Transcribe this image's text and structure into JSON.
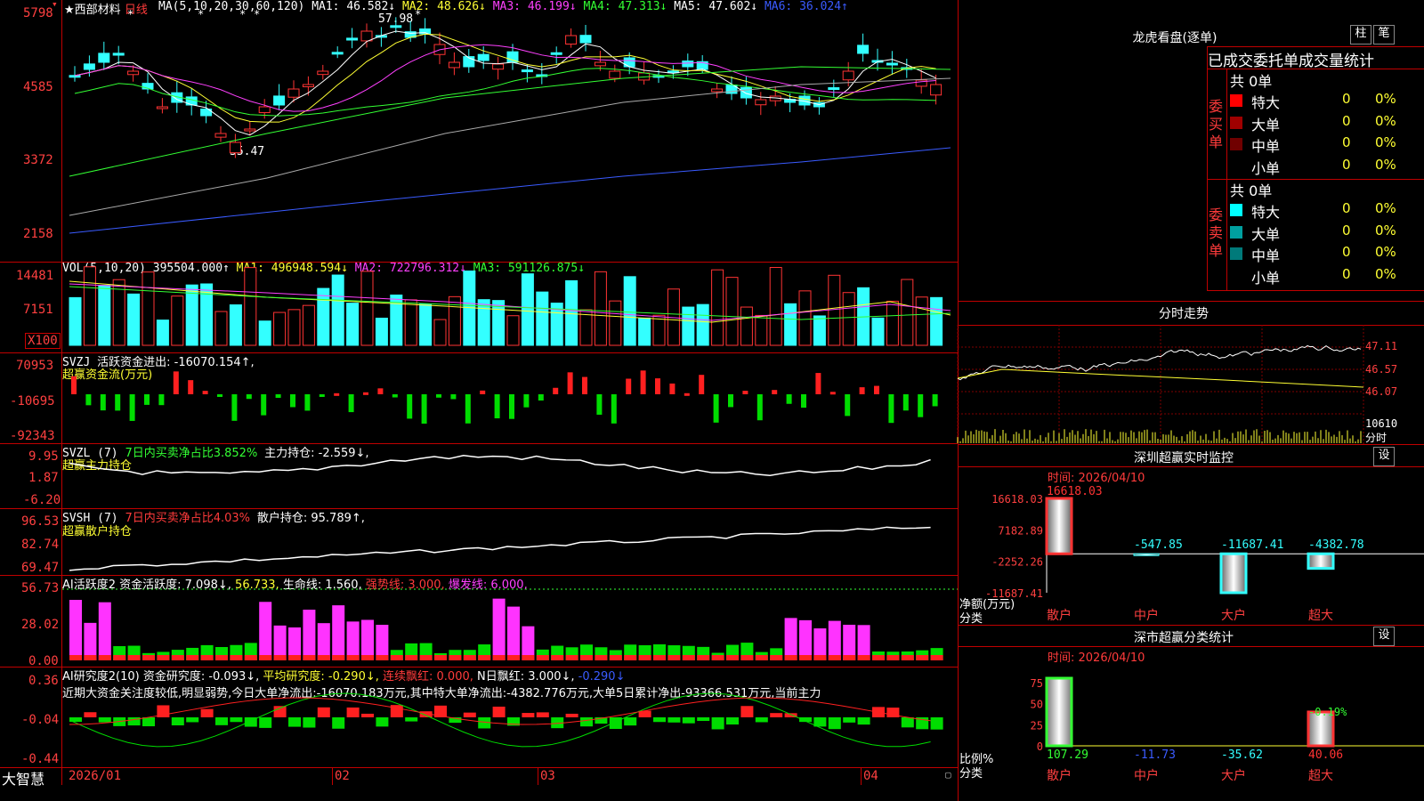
{
  "stock": {
    "star": "★",
    "name": "西部材料",
    "period": "日线"
  },
  "ma_header": {
    "label": "MA(5,10,20,30,60,120)",
    "ma1": "MA1: 46.582↓",
    "ma2": "MA2: 48.626↓",
    "ma3": "MA3: 46.199↓",
    "ma4": "MA4: 47.313↓",
    "ma5": "MA5: 47.602↓",
    "ma6": "MA6: 36.024↑"
  },
  "price_axis": [
    "5798",
    "4585",
    "3372",
    "2158"
  ],
  "price_annotations": {
    "high": "57.98",
    "low": "35.47"
  },
  "vol_header": {
    "label": "VOL(5,10,20)",
    "value": "395504.000↑",
    "ma1": "MA1: 496948.594↓",
    "ma2": "MA2: 722796.312↓",
    "ma3": "MA3: 591126.875↓"
  },
  "vol_axis": [
    "14481",
    "7151",
    "X100"
  ],
  "svzj": {
    "label": "SVZJ",
    "title": "活跃资金进出: -16070.154↑,",
    "subtitle": "超赢资金流(万元)",
    "axis": [
      "70953",
      "-10695",
      "-92343"
    ]
  },
  "svzl": {
    "label": "SVZL (7)",
    "ratio": "7日内买卖净占比3.852%",
    "pos": "主力持仓: -2.559↓,",
    "subtitle": "超赢主力持仓",
    "axis": [
      "9.95",
      "1.87",
      "-6.20"
    ]
  },
  "svsh": {
    "label": "SVSH (7)",
    "ratio": "7日内买卖净占比4.03%",
    "pos": "散户持仓: 95.789↑,",
    "subtitle": "超赢散户持仓",
    "axis": [
      "96.53",
      "82.74",
      "69.47"
    ]
  },
  "ai_active": {
    "label": "AI活跃度2",
    "act": "资金活跃度: 7.098↓,",
    "v2": "56.733,",
    "life": "生命线: 1.560,",
    "strong": "强势线: 3.000,",
    "burst": "爆发线: 6.000,",
    "axis": [
      "56.73",
      "28.02",
      "0.00"
    ]
  },
  "ai_research": {
    "label": "AI研究度2(10)",
    "res": "资金研究度: -0.093↓,",
    "avg": "平均研究度: -0.290↓,",
    "cont": "连续飘红: 0.000,",
    "nred": "N日飘红: 3.000↓,",
    "neg": "-0.290↓",
    "axis": [
      "0.36",
      "-0.04",
      "-0.44"
    ]
  },
  "comment": "近期大资金关注度较低,明显弱势,今日大单净流出:-16070.183万元,其中特大单净流出:-4382.776万元,大单5日累计净出-93366.531万元,当前主力",
  "date_axis": [
    "2026/01",
    "02",
    "03",
    "04"
  ],
  "footer_brand": "大智慧",
  "dragon": {
    "title": "龙虎看盘(逐单)",
    "btn1": "柱",
    "btn2": "笔",
    "header": "已成交委托单成交量统计",
    "buy_label": "委买单",
    "sell_label": "委卖单",
    "buy_total": "共 0单",
    "sell_total": "共 0单",
    "buy_rows": [
      {
        "name": "特大",
        "num": "0",
        "pct": "0%",
        "color": "#ff0000"
      },
      {
        "name": "大单",
        "num": "0",
        "pct": "0%",
        "color": "#a00000"
      },
      {
        "name": "中单",
        "num": "0",
        "pct": "0%",
        "color": "#700000"
      },
      {
        "name": "小单",
        "num": "0",
        "pct": "0%",
        "color": ""
      }
    ],
    "sell_rows": [
      {
        "name": "特大",
        "num": "0",
        "pct": "0%",
        "color": "#00ffff"
      },
      {
        "name": "大单",
        "num": "0",
        "pct": "0%",
        "color": "#00a0a0"
      },
      {
        "name": "中单",
        "num": "0",
        "pct": "0%",
        "color": "#007a7a"
      },
      {
        "name": "小单",
        "num": "0",
        "pct": "0%",
        "color": ""
      }
    ]
  },
  "intraday": {
    "title": "分时走势",
    "axis": [
      "47.11",
      "46.57",
      "46.07"
    ],
    "vol_axis": "10610",
    "unit": "分时"
  },
  "sz_monitor": {
    "title": "深圳超赢实时监控",
    "btn": "设",
    "time": "时间: 2026/04/10",
    "axis": [
      "16618.03",
      "7182.89",
      "-2252.26",
      "-11687.41"
    ],
    "unit_line1": "净额(万元)",
    "unit_line2": "分类",
    "categories": [
      "散户",
      "中户",
      "大户",
      "超大"
    ],
    "values": [
      16618.03,
      -547.85,
      -11687.41,
      -4382.78
    ],
    "labels": [
      "16618.03",
      "-547.85",
      "-11687.41",
      "-4382.78"
    ]
  },
  "sz_stats": {
    "title": "深市超赢分类统计",
    "btn": "设",
    "time": "时间: 2026/04/10",
    "axis": [
      "75",
      "50",
      "25",
      "0"
    ],
    "unit_line1": "比例%",
    "unit_line2": "分类",
    "categories": [
      "散户",
      "中户",
      "大户",
      "超大"
    ],
    "values": [
      107.29,
      -11.73,
      -35.62,
      40.06
    ],
    "labels": [
      "107.29",
      "-11.73",
      "-35.62",
      "40.06"
    ],
    "annotation": "-0.19%"
  },
  "colors": {
    "up": "#ff3333",
    "down": "#33ffff",
    "border": "#c00000"
  }
}
